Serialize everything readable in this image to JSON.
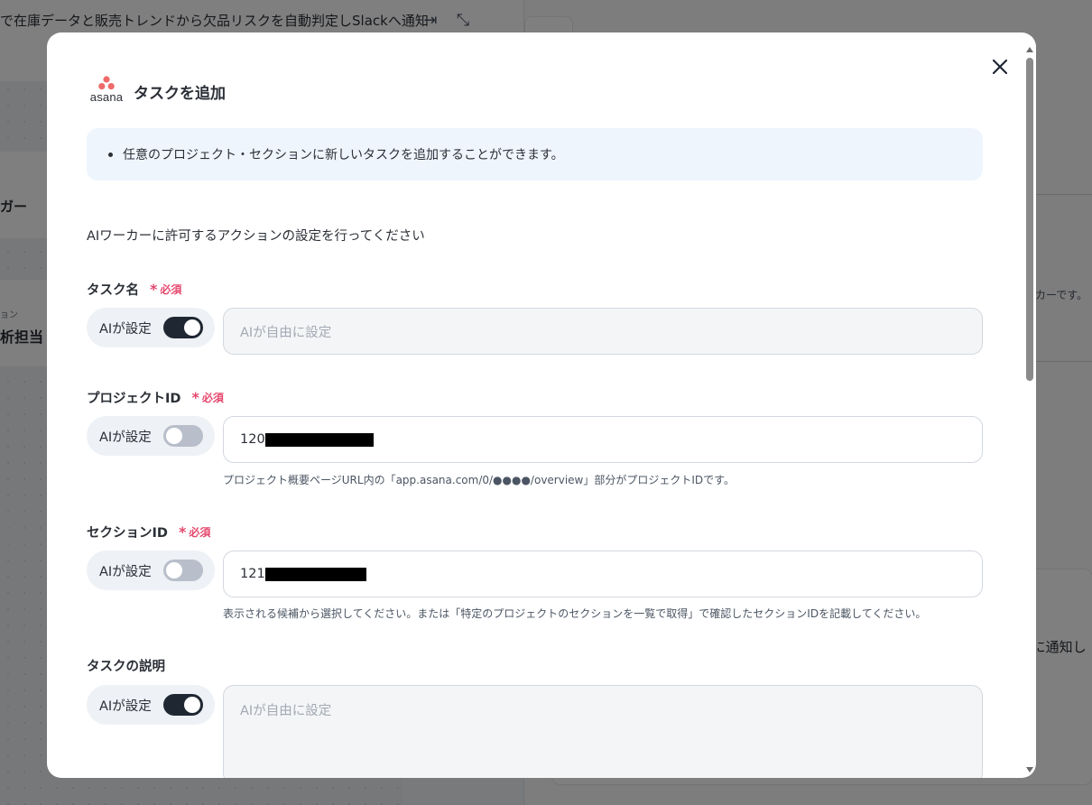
{
  "background": {
    "title": "で在庫データと販売トレンドから欠品リスクを自動判定しSlackへ通知",
    "left_card1": "ガー",
    "left_card2_sub": "ョン",
    "left_card2_main": "析担当",
    "right_text1": "ーカーです。",
    "right_text2": "kに通知し"
  },
  "modal": {
    "app_logo_text": "asana",
    "title": "タスクを追加",
    "info": "任意のプロジェクト・セクションに新しいタスクを追加することができます。",
    "intro": "AIワーカーに許可するアクションの設定を行ってください",
    "ai_label": "AIが設定",
    "required": "必須",
    "fields": {
      "task_name": {
        "label": "タスク名",
        "ai_on": true,
        "placeholder": "AIが自由に設定"
      },
      "project_id": {
        "label": "プロジェクトID",
        "ai_on": false,
        "value": "120",
        "hint": "プロジェクト概要ページURL内の「app.asana.com/0/●●●●/overview」部分がプロジェクトIDです。"
      },
      "section_id": {
        "label": "セクションID",
        "ai_on": false,
        "value": "121",
        "hint": "表示される候補から選択してください。または「特定のプロジェクトのセクションを一覧で取得」で確認したセクションIDを記載してください。"
      },
      "task_desc": {
        "label": "タスクの説明",
        "ai_on": true,
        "placeholder": "AIが自由に設定"
      }
    }
  }
}
